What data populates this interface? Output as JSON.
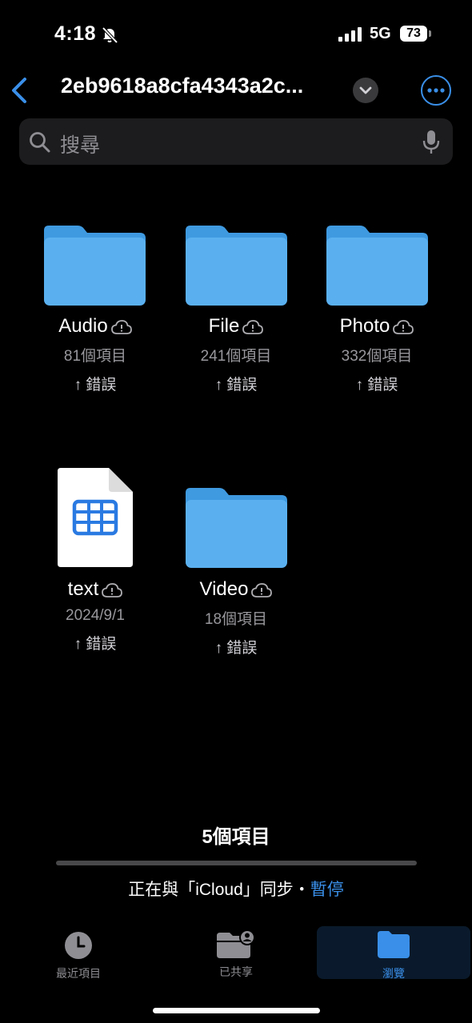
{
  "status_bar": {
    "time": "4:18",
    "network": "5G",
    "battery": "73"
  },
  "nav": {
    "title": "2eb9618a8cfa4343a2c..."
  },
  "search": {
    "placeholder": "搜尋"
  },
  "items": [
    {
      "name": "Audio",
      "detail": "81個項目",
      "status": "↑ 錯誤"
    },
    {
      "name": "File",
      "detail": "241個項目",
      "status": "↑ 錯誤"
    },
    {
      "name": "Photo",
      "detail": "332個項目",
      "status": "↑ 錯誤"
    },
    {
      "name": "text",
      "detail": "2024/9/1",
      "status": "↑ 錯誤"
    },
    {
      "name": "Video",
      "detail": "18個項目",
      "status": "↑ 錯誤"
    }
  ],
  "footer": {
    "count": "5個項目",
    "sync_text": "正在與「iCloud」同步・",
    "pause_label": "暫停"
  },
  "tabs": [
    {
      "label": "最近項目",
      "icon": "clock-icon",
      "active": false
    },
    {
      "label": "已共享",
      "icon": "shared-folder-icon",
      "active": false
    },
    {
      "label": "瀏覽",
      "icon": "folder-icon",
      "active": true
    }
  ],
  "colors": {
    "accent": "#3a8fe8",
    "folder": "#5ab0ef",
    "background": "#000000"
  }
}
